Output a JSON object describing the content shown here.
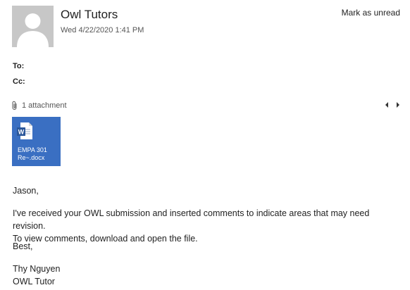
{
  "header": {
    "sender_name": "Owl Tutors",
    "date": "Wed 4/22/2020 1:41 PM",
    "mark_unread_label": "Mark as unread",
    "avatar_icon": "person-silhouette-icon"
  },
  "recipients": {
    "to_label": "To:",
    "cc_label": "Cc:"
  },
  "attachments": {
    "count_label": "1 attachment",
    "icon": "paperclip-icon",
    "items": [
      {
        "file_type": "word-doc-icon",
        "name": "EMPA 301\nRe~.docx"
      }
    ],
    "tile_color": "#3a6fc2"
  },
  "message": {
    "greeting": "Jason,",
    "line1": "I've received your OWL submission and inserted comments to indicate areas that may need revision.",
    "line2": "To view comments, download and open the file.",
    "closing": "Best,",
    "signature_name": "Thy Nguyen",
    "signature_title": "OWL Tutor"
  }
}
